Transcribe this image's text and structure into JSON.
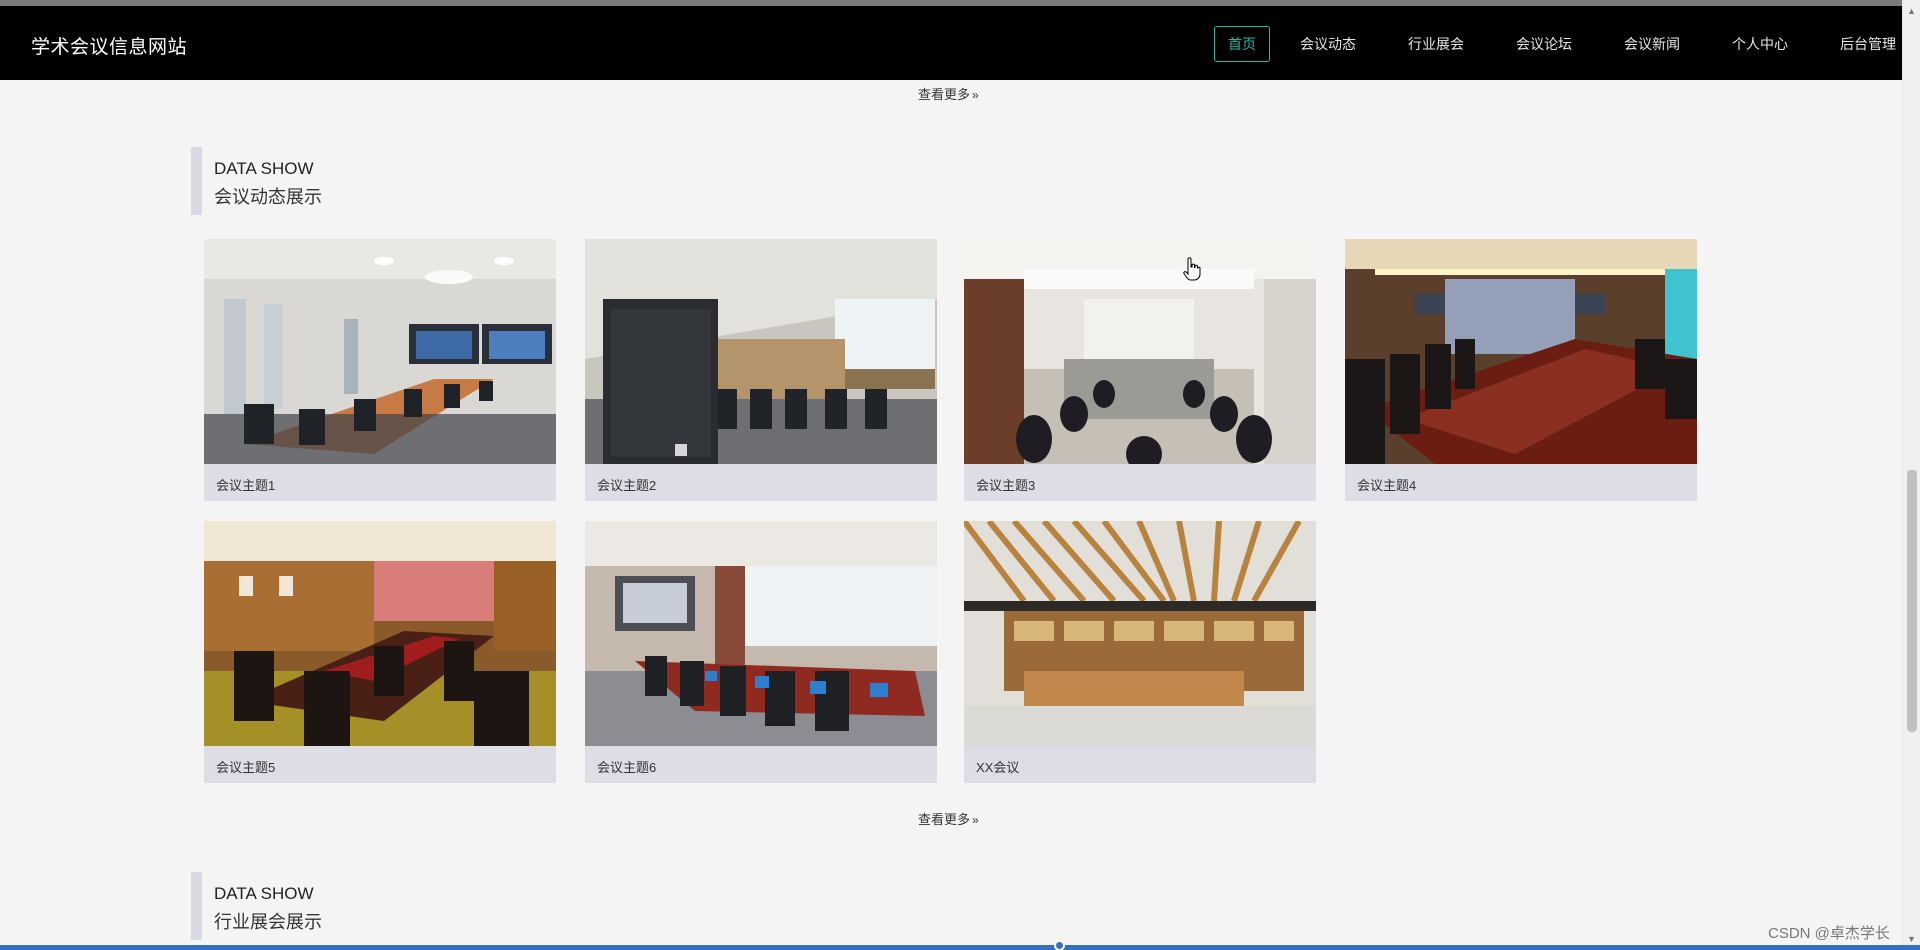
{
  "header": {
    "site_title": "学术会议信息网站",
    "nav": [
      {
        "label": "首页",
        "active": true
      },
      {
        "label": "会议动态",
        "active": false
      },
      {
        "label": "行业展会",
        "active": false
      },
      {
        "label": "会议论坛",
        "active": false
      },
      {
        "label": "会议新闻",
        "active": false
      },
      {
        "label": "个人中心",
        "active": false
      },
      {
        "label": "后台管理",
        "active": false
      }
    ],
    "active_color": "#24b5a5"
  },
  "more_top": {
    "label": "查看更多",
    "arrows": "»"
  },
  "section_dynamics": {
    "title_en": "DATA SHOW",
    "title_cn": "会议动态展示",
    "cards": [
      {
        "caption": "会议主题1",
        "image": "conference-room-photo"
      },
      {
        "caption": "会议主题2",
        "image": "conference-room-with-speaker-photo"
      },
      {
        "caption": "会议主题3",
        "image": "meeting-room-photo"
      },
      {
        "caption": "会议主题4",
        "image": "boardroom-photo"
      },
      {
        "caption": "会议主题5",
        "image": "wooden-boardroom-photo"
      },
      {
        "caption": "会议主题6",
        "image": "conference-hall-photo"
      },
      {
        "caption": "XX会议",
        "image": "bookstore-interior-photo"
      }
    ],
    "more": {
      "label": "查看更多",
      "arrows": "»"
    }
  },
  "section_exhibitions": {
    "title_en": "DATA SHOW",
    "title_cn": "行业展会展示"
  },
  "watermark": "CSDN @卓杰学长"
}
